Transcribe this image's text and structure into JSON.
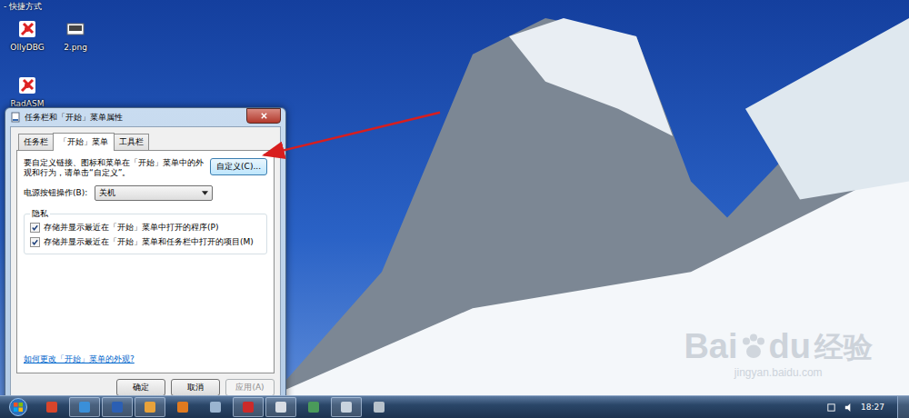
{
  "desktop": {
    "caption": "- 快捷方式",
    "icons": [
      {
        "label": "OllyDBG"
      },
      {
        "label": "2.png"
      },
      {
        "label": "RadASM"
      }
    ]
  },
  "window": {
    "title": "任务栏和「开始」菜单属性"
  },
  "tabs": [
    {
      "label": "任务栏",
      "selected": false
    },
    {
      "label": "「开始」菜单",
      "selected": true
    },
    {
      "label": "工具栏",
      "selected": false
    }
  ],
  "description": "要自定义链接、图标和菜单在「开始」菜单中的外观和行为，请单击“自定义”。",
  "customize_button": "自定义(C)...",
  "power": {
    "label": "电源按钮操作(B):",
    "value": "关机"
  },
  "privacy": {
    "title": "隐私",
    "options": [
      {
        "label": "存储并显示最近在「开始」菜单中打开的程序(P)",
        "checked": true
      },
      {
        "label": "存储并显示最近在「开始」菜单和任务栏中打开的项目(M)",
        "checked": true
      }
    ]
  },
  "help_link": "如何更改「开始」菜单的外观?",
  "buttons": [
    {
      "label": "确定",
      "disabled": false
    },
    {
      "label": "取消",
      "disabled": false
    },
    {
      "label": "应用(A)",
      "disabled": true
    }
  ],
  "watermark": {
    "left": "Bai",
    "right": "du",
    "product": "经验",
    "url": "jingyan.baidu.com"
  },
  "taskbar": {
    "items": [
      {
        "running": false,
        "color": "#d9452b"
      },
      {
        "running": true,
        "color": "#3a8fd8"
      },
      {
        "running": true,
        "color": "#2b5fb4"
      },
      {
        "running": true,
        "color": "#e8a23a"
      },
      {
        "running": false,
        "color": "#e07a1f"
      },
      {
        "running": false,
        "color": "#9ab4d0"
      },
      {
        "running": true,
        "color": "#cc2a2a"
      },
      {
        "running": true,
        "color": "#d8dde4"
      },
      {
        "running": false,
        "color": "#4a9a5a"
      },
      {
        "running": true,
        "color": "#c8d3de"
      },
      {
        "running": false,
        "color": "#b7c2cc"
      }
    ],
    "clock": "18:27"
  }
}
